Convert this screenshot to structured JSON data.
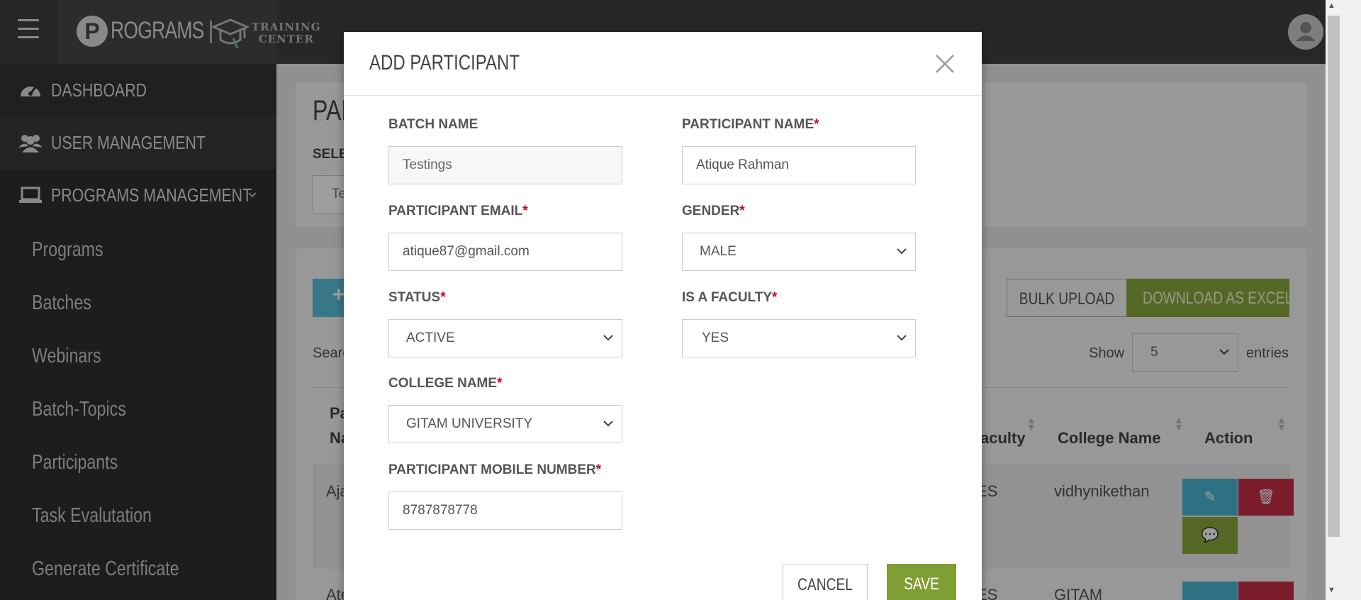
{
  "brand": {
    "logo_letter": "P",
    "logo_text": "ROGRAMS |",
    "logo_sub_line1": "TRAINING",
    "logo_sub_line2": "CENTER"
  },
  "sidebar": {
    "top_items": [
      {
        "label": "DASHBOARD",
        "icon": "dashboard-gauge-icon"
      },
      {
        "label": "USER MANAGEMENT",
        "icon": "users-group-icon"
      },
      {
        "label": "PROGRAMS MANAGEMENT",
        "icon": "laptop-icon",
        "expanded": true
      }
    ],
    "sub_items": [
      {
        "label": "Programs"
      },
      {
        "label": "Batches"
      },
      {
        "label": "Webinars"
      },
      {
        "label": "Batch-Topics"
      },
      {
        "label": "Participants"
      },
      {
        "label": "Task Evalutation"
      },
      {
        "label": "Generate Certificate"
      }
    ]
  },
  "background_page": {
    "title_fragment": "PAR",
    "select_label_fragment": "SELE",
    "select_value_fragment": "Te",
    "add_button_glyph": "+",
    "bulk_upload_label": "BULK UPLOAD",
    "download_excel_label": "DOWNLOAD AS EXCEL",
    "search_label_fragment": "Searc",
    "show_label": "Show",
    "entries_value": "5",
    "entries_label": "entries",
    "table": {
      "headers": {
        "col1_line1": "Pa",
        "col1_line2": "Na",
        "faculty": "aculty",
        "college": "College Name",
        "action": "Action"
      },
      "rows": [
        {
          "name_fragment": "Aja",
          "faculty_fragment": "ES",
          "college": "vidhynikethan"
        },
        {
          "name_fragment": "Ate",
          "faculty_fragment": "ES",
          "college": "GITAM"
        }
      ]
    }
  },
  "modal": {
    "title": "ADD PARTICIPANT",
    "fields": {
      "batch_name": {
        "label": "BATCH NAME",
        "required": false,
        "value": "Testings",
        "readonly": true
      },
      "participant_name": {
        "label": "PARTICIPANT NAME",
        "required": true,
        "value": "Atique Rahman"
      },
      "participant_email": {
        "label": "PARTICIPANT EMAIL",
        "required": true,
        "value": "atique87@gmail.com"
      },
      "gender": {
        "label": "GENDER",
        "required": true,
        "value": "MALE"
      },
      "status": {
        "label": "STATUS",
        "required": true,
        "value": "ACTIVE"
      },
      "is_faculty": {
        "label": "IS A FACULTY",
        "required": true,
        "value": "YES"
      },
      "college_name": {
        "label": "COLLEGE NAME",
        "required": true,
        "value": "GITAM UNIVERSITY"
      },
      "mobile_number": {
        "label": "PARTICIPANT MOBILE NUMBER",
        "required": true,
        "value": "8787878778"
      }
    },
    "required_marker": "*",
    "cancel_label": "CANCEL",
    "save_label": "SAVE"
  },
  "colors": {
    "sidebar_bg": "#2f2f2f",
    "topbar_bg": "#3f3f3f",
    "accent_green": "#7f9e33",
    "accent_blue": "#5bc0de",
    "danger_red": "#c9304a",
    "required_red": "#d0021b"
  }
}
